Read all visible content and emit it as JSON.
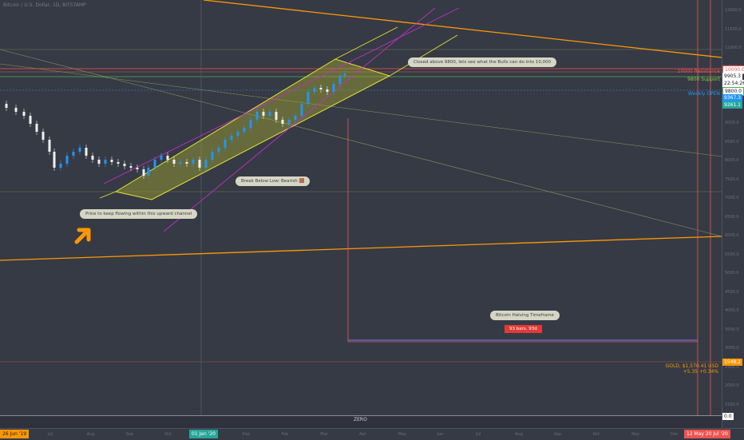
{
  "chart": {
    "title": "Bitcoin / U.S. Dollar, 1D, BITSTAMP"
  },
  "price_axis": {
    "ticks": [
      "12000.0",
      "11500.0",
      "11000.0",
      "10500.0",
      "10000.0",
      "9500.0",
      "9000.0",
      "8500.0",
      "8000.0",
      "7500.0",
      "7000.0",
      "6500.0",
      "6000.0",
      "5500.0",
      "5000.0",
      "4500.0",
      "4000.0",
      "3500.0",
      "3000.0",
      "2500.0",
      "2000.0",
      "1500.0"
    ],
    "labels": {
      "resistance_price": "10000.0",
      "last_price": "9905.3",
      "countdown": "22:54:26",
      "support_price": "9800.0",
      "weekly_open_1": "9367.3",
      "weekly_open_2": "9261.1",
      "gold_price": "1548.2",
      "zero_price": "0.0"
    }
  },
  "annotations": {
    "resistance": "10000 Resistance",
    "support": "9800 Support",
    "weekly_open": "Weekly OPEN",
    "closed_above": "Closed above 9800, lets see what the Bulls can do into 10,000",
    "break_below": "Break Below Low: Bearish 🟫",
    "price_channel": "Price to keep flowing within this upward channel",
    "halving_timeframe": "Bitcoin Halving Timeframe",
    "halving_range": "93 bars, 93d",
    "gold_line1": "GOLD, $1,570.41 USD",
    "gold_line2": "+5.35 +0.34%",
    "zero": "ZERO"
  },
  "time_axis": {
    "start_label": "26 Jun '19",
    "mid_label": "01 Jan '20",
    "end_label": "12 May 20 Jul '20",
    "ticks": [
      "Jul",
      "Aug",
      "Sep",
      "Oct",
      "Nov",
      "Dec",
      "Feb",
      "Mar",
      "Apr",
      "May",
      "Jun",
      "Jul",
      "Aug",
      "Sep",
      "Oct",
      "Nov",
      "Dec"
    ]
  },
  "colors": {
    "background": "#363a45",
    "resistance": "#ef5350",
    "support": "#4caf50",
    "weekly": "#2196f3",
    "orange_trend": "#ff9800",
    "channel": "#e6e632",
    "magenta": "#c030c8",
    "candle_up": "#2196f3",
    "candle_down": "#f0f0f0"
  },
  "icons": {
    "arrow": "orange-arrow-icon"
  }
}
